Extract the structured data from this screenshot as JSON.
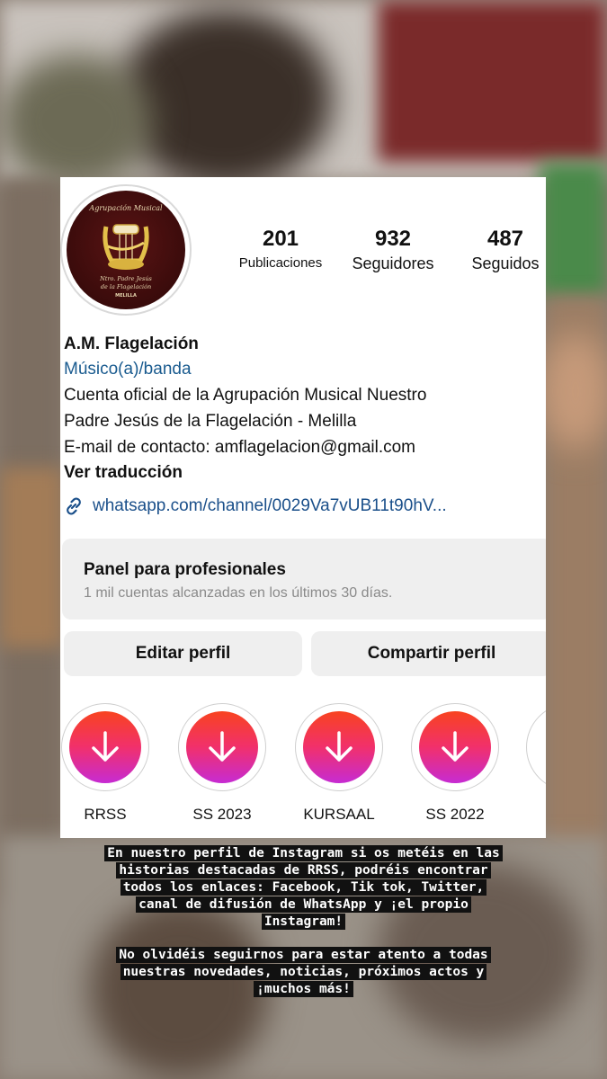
{
  "profile": {
    "logo_lines": [
      "Agrupación Musical",
      "Ntro. Padre Jesús",
      "de la Flagelación",
      "MELILLA"
    ],
    "name": "A.M. Flagelación",
    "category": "Músico(a)/banda",
    "bio_lines": [
      "Cuenta oficial de la Agrupación Musical Nuestro",
      "Padre Jesús de la Flagelación - Melilla",
      "E-mail de contacto: amflagelacion@gmail.com"
    ],
    "translate": "Ver traducción",
    "link": "whatsapp.com/channel/0029Va7vUB11t90hV..."
  },
  "stats": [
    {
      "value": "201",
      "label": "Publicaciones"
    },
    {
      "value": "932",
      "label": "Seguidores"
    },
    {
      "value": "487",
      "label": "Seguidos"
    }
  ],
  "dashboard": {
    "title": "Panel para profesionales",
    "subtitle": "1 mil cuentas alcanzadas en los últimos 30 días."
  },
  "buttons": {
    "edit": "Editar perfil",
    "share": "Compartir perfil"
  },
  "highlights": [
    {
      "label": "RRSS",
      "icon": "down-arrow-icon"
    },
    {
      "label": "SS 2023",
      "icon": "down-arrow-icon"
    },
    {
      "label": "KURSAAL",
      "icon": "down-arrow-icon"
    },
    {
      "label": "SS 2022",
      "icon": "down-arrow-icon"
    }
  ],
  "caption": {
    "p1": "En nuestro perfil de Instagram si os metéis en las historias destacadas de RRSS, podréis encontrar todos los enlaces: Facebook, Tik tok, Twitter, canal de difusión de WhatsApp y ¡el propio Instagram!",
    "p2": "No olvidéis seguirnos para estar atento a todas nuestras novedades, noticias, próximos actos y ¡muchos más!"
  },
  "colors": {
    "link": "#1a4f8a",
    "highlight_gradient": [
      "#f8431f",
      "#f1306c",
      "#c62bd3"
    ],
    "panel_bg": "#efefef"
  }
}
